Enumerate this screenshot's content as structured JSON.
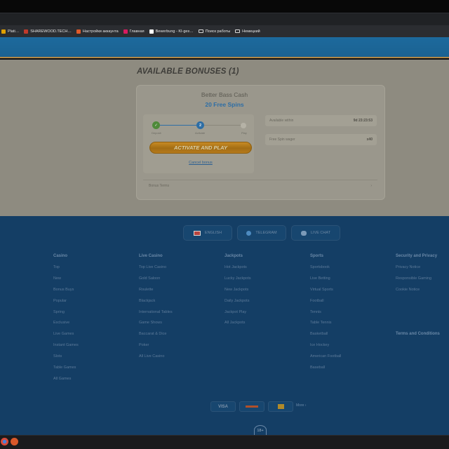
{
  "browser": {
    "bookmarks": [
      {
        "label": "Plati…",
        "color": "#e0a000",
        "folder": false
      },
      {
        "label": "SHAREWOOD.TECH…",
        "color": "#c03a2b",
        "folder": false
      },
      {
        "label": "Настройки аккаунта",
        "color": "#e05a2a",
        "folder": false
      },
      {
        "label": "Главная",
        "color": "#d81b60",
        "folder": false
      },
      {
        "label": "Bewerbung - KI-ges…",
        "color": "#ffffff",
        "folder": false
      },
      {
        "label": "Поиск работы",
        "color": "",
        "folder": true
      },
      {
        "label": "Немецкий",
        "color": "",
        "folder": true
      }
    ]
  },
  "bonuses": {
    "title": "AVAILABLE BONUSES (1)",
    "card": {
      "name": "Better Bass Cash",
      "subtitle": "20 Free Spins",
      "steps": [
        "Deposit",
        "Activate",
        "Play"
      ],
      "current_step": 2,
      "activate_label": "ACTIVATE AND PLAY",
      "cancel_label": "Cancel bonus",
      "available_label": "Available within",
      "available_value": "9d 23:23:53",
      "wager_label": "Free Spin wager",
      "wager_value": "x40",
      "terms_label": "Bonus Terms"
    }
  },
  "footer": {
    "pills": {
      "language": "ENGLISH",
      "telegram": "TELEGRAM",
      "chat": "LIVE CHAT"
    },
    "columns": [
      {
        "title": "Casino",
        "items": [
          "Top",
          "New",
          "Bonus Buys",
          "Popular",
          "Spring",
          "Exclusive",
          "Live Games",
          "Instant Games",
          "Slots",
          "Table Games",
          "All Games"
        ]
      },
      {
        "title": "Live Casino",
        "items": [
          "Top Live Casino",
          "Gold Saloon",
          "Roulette",
          "Blackjack",
          "International Tables",
          "Game Shows",
          "Baccarat & Dice",
          "Poker",
          "All Live Casino"
        ]
      },
      {
        "title": "Jackpots",
        "items": [
          "Hot Jackpots",
          "Lucky Jackpots",
          "New Jackpots",
          "Daily Jackpots",
          "Jackpot Play",
          "All Jackpots"
        ]
      },
      {
        "title": "Sports",
        "items": [
          "Sportsbook",
          "Live Betting",
          "Virtual Sports",
          "Football",
          "Tennis",
          "Table Tennis",
          "Basketball",
          "Ice Hockey",
          "American Football",
          "Baseball"
        ]
      },
      {
        "title": "Security and Privacy",
        "items": [
          "Privacy Notice",
          "Responsible Gaming",
          "Cookie Notice"
        ]
      },
      {
        "title": "Terms and Conditions",
        "items": []
      }
    ],
    "payments": {
      "visa": "VISA",
      "more": "More"
    },
    "age": "18+"
  }
}
